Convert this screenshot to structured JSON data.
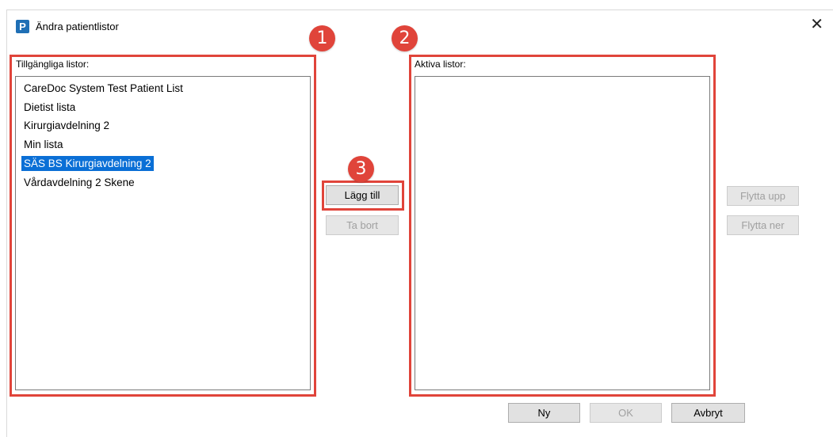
{
  "window": {
    "title": "Ändra patientlistor",
    "icon": "P",
    "close_glyph": "✕"
  },
  "available": {
    "label": "Tillgängliga listor:",
    "items": [
      "CareDoc System Test Patient List",
      "Dietist lista",
      "Kirurgiavdelning 2",
      "Min lista",
      "SÄS BS Kirurgiavdelning 2",
      "Vårdavdelning 2 Skene"
    ],
    "selected_index": 4
  },
  "active": {
    "label": "Aktiva listor:",
    "items": []
  },
  "buttons": {
    "add": "Lägg till",
    "remove": "Ta bort",
    "move_up": "Flytta upp",
    "move_down": "Flytta ner",
    "new": "Ny",
    "ok": "OK",
    "cancel": "Avbryt"
  },
  "badges": [
    "1",
    "2",
    "3"
  ],
  "colors": {
    "highlight": "#e0443a",
    "selection": "#0a6fd6"
  }
}
